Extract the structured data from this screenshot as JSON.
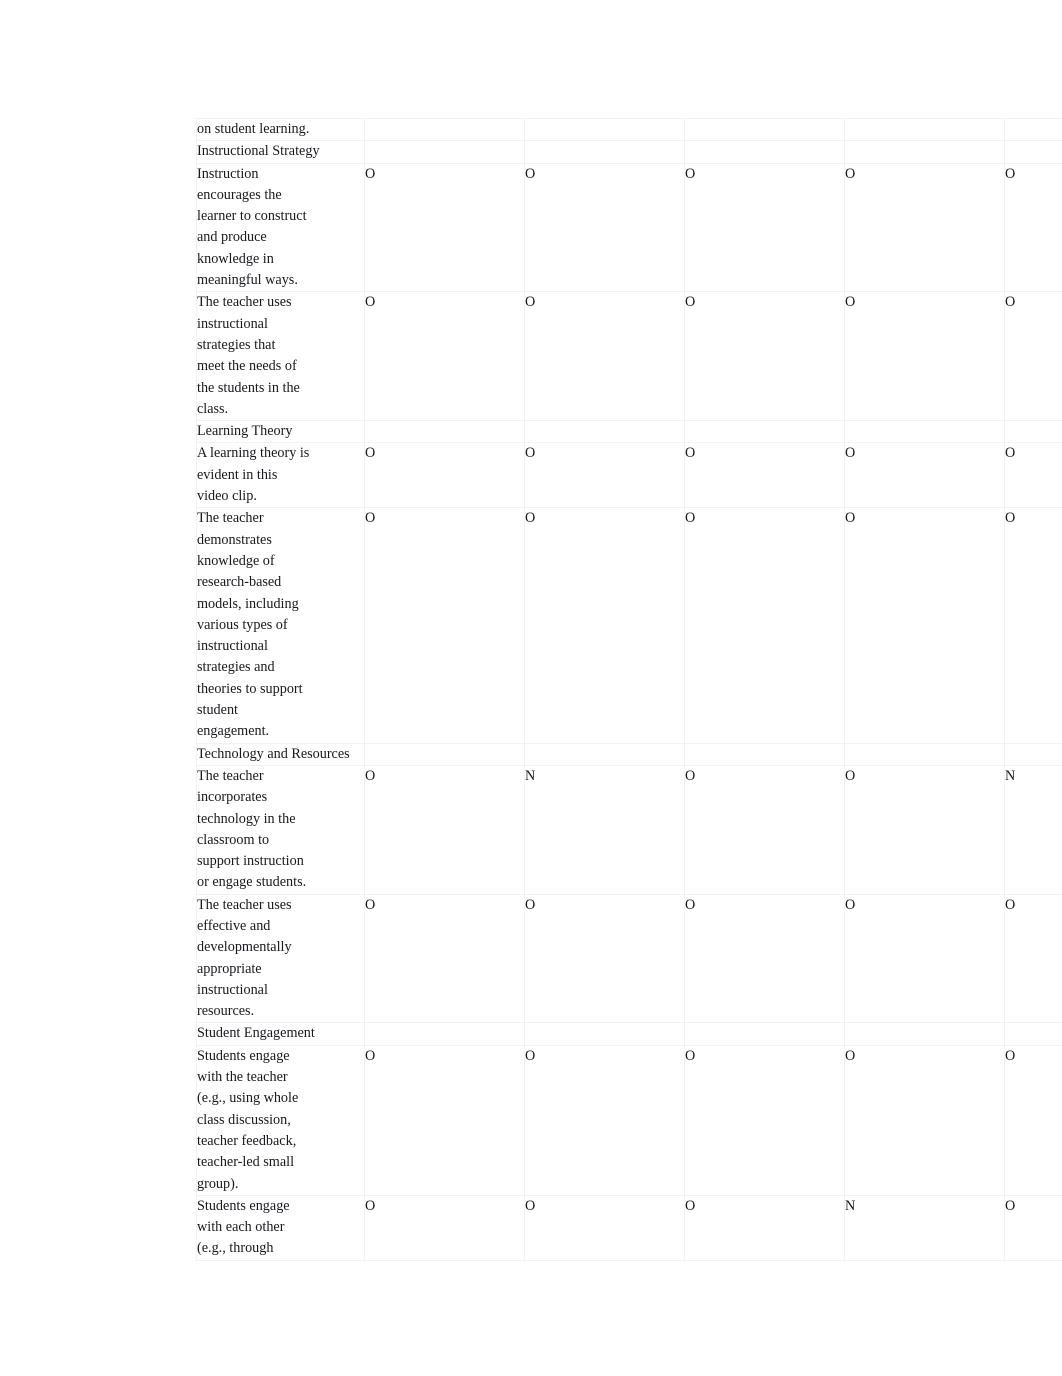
{
  "document": {
    "type": "rubric-observation-table",
    "columns": {
      "criterion_header": "",
      "rating_columns": [
        "",
        "",
        "",
        "",
        ""
      ],
      "count": 5
    },
    "marks": {
      "observed": "O",
      "not_observed": "N"
    },
    "colors": {
      "page_background": "#ffffff",
      "cell_background": "#ffffff",
      "section_row_background": "#f7f7f8",
      "gridline": "#f0f0f1",
      "text": "#18181f"
    }
  },
  "rows": [
    {
      "kind": "continuation",
      "criterion_lines": [
        "on student learning."
      ],
      "ratings": [
        "",
        "",
        "",
        "",
        ""
      ]
    },
    {
      "kind": "section",
      "criterion_lines": [
        "Instructional Strategy"
      ],
      "ratings": [
        "",
        "",
        "",
        "",
        ""
      ]
    },
    {
      "kind": "item",
      "criterion_lines": [
        "Instruction",
        "encourages the",
        "learner to construct",
        "and produce",
        "knowledge in",
        "meaningful ways."
      ],
      "ratings": [
        "O",
        "O",
        "O",
        "O",
        "O"
      ]
    },
    {
      "kind": "item",
      "criterion_lines": [
        "The teacher uses",
        "instructional",
        "strategies that",
        "meet the needs of",
        "the students in the",
        "class."
      ],
      "ratings": [
        "O",
        "O",
        "O",
        "O",
        "O"
      ]
    },
    {
      "kind": "section",
      "criterion_lines": [
        "Learning Theory"
      ],
      "ratings": [
        "",
        "",
        "",
        "",
        ""
      ]
    },
    {
      "kind": "item",
      "criterion_lines": [
        "A learning theory is",
        "evident in this",
        "video clip."
      ],
      "ratings": [
        "O",
        "O",
        "O",
        "O",
        "O"
      ]
    },
    {
      "kind": "item",
      "shift": true,
      "criterion_lines": [
        "The teacher",
        "demonstrates",
        "knowledge of",
        "research-based",
        "models, including",
        "various types of",
        "instructional",
        "strategies and",
        "theories to support",
        "student",
        "engagement."
      ],
      "ratings": [
        "O",
        "O",
        "O",
        "O",
        "O"
      ]
    },
    {
      "kind": "section",
      "criterion_lines": [
        "Technology and Resources"
      ],
      "ratings": [
        "",
        "",
        "",
        "",
        ""
      ]
    },
    {
      "kind": "item",
      "criterion_lines": [
        "The teacher",
        "incorporates",
        "technology in the",
        "classroom to",
        "support instruction",
        "or engage students."
      ],
      "ratings": [
        "O",
        "N",
        "O",
        "O",
        "N"
      ]
    },
    {
      "kind": "item",
      "shift": true,
      "criterion_lines": [
        "The teacher uses",
        "effective and",
        "developmentally",
        "appropriate",
        "instructional",
        "resources."
      ],
      "ratings": [
        "O",
        "O",
        "O",
        "O",
        "O"
      ]
    },
    {
      "kind": "section",
      "criterion_lines": [
        "Student Engagement"
      ],
      "ratings": [
        "",
        "",
        "",
        "",
        ""
      ]
    },
    {
      "kind": "item",
      "criterion_lines": [
        "Students engage",
        "with the teacher",
        "(e.g., using whole",
        "class discussion,",
        "teacher feedback,",
        "teacher-led small",
        "group)."
      ],
      "ratings": [
        "O",
        "O",
        "O",
        "O",
        "O"
      ]
    },
    {
      "kind": "item",
      "criterion_lines": [
        "Students engage",
        "with each other",
        "(e.g., through"
      ],
      "ratings": [
        "O",
        "O",
        "O",
        "N",
        "O"
      ]
    }
  ]
}
